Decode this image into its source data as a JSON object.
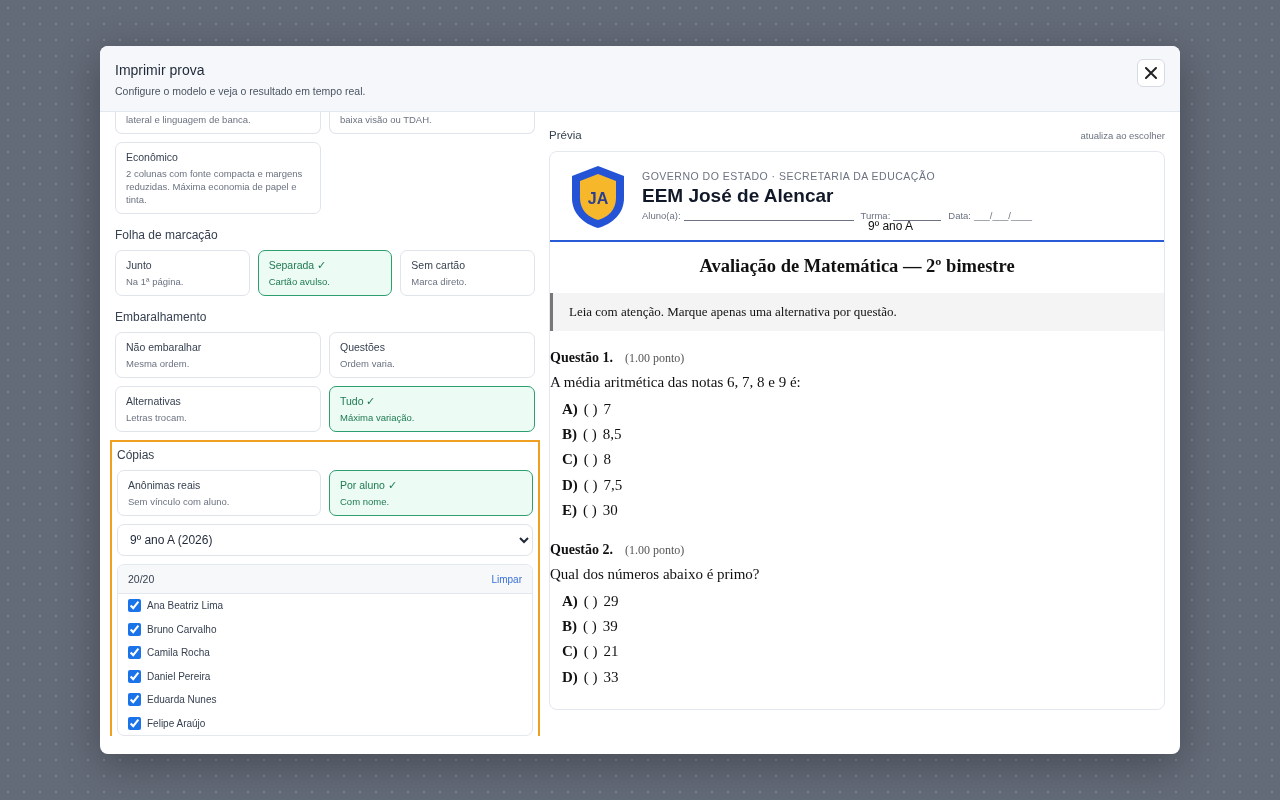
{
  "dialog": {
    "title": "Imprimir prova",
    "subtitle": "Configure o modelo e veja o resultado em tempo real."
  },
  "layout_options": [
    {
      "description": "lateral e linguagem de banca.",
      "selected": false
    },
    {
      "description": "baixa visão ou TDAH.",
      "selected": false
    },
    {
      "title": "Econômico",
      "description": "2 colunas com fonte compacta e margens reduzidas. Máxima economia de papel e tinta.",
      "selected": false
    }
  ],
  "sections": [
    {
      "heading": "Folha de marcação",
      "options": [
        {
          "title": "Junto",
          "description": "Na 1ª página.",
          "selected": false
        },
        {
          "title": "Separada ✓",
          "description": "Cartão avulso.",
          "selected": true
        },
        {
          "title": "Sem cartão",
          "description": "Marca direto.",
          "selected": false
        }
      ]
    },
    {
      "heading": "Embaralhamento",
      "options": [
        {
          "title": "Não embaralhar",
          "description": "Mesma ordem.",
          "selected": false
        },
        {
          "title": "Questões",
          "description": "Ordem varia.",
          "selected": false
        },
        {
          "title": "Alternativas",
          "description": "Letras trocam.",
          "selected": false
        },
        {
          "title": "Tudo ✓",
          "description": "Máxima variação.",
          "selected": true
        }
      ]
    }
  ],
  "copies": {
    "heading": "Cópias",
    "highlighted": true,
    "options": [
      {
        "title": "Anônimas reais",
        "description": "Sem vínculo com aluno.",
        "selected": false
      },
      {
        "title": "Por aluno ✓",
        "description": "Com nome.",
        "selected": true
      }
    ],
    "class_select": "9º ano A (2026)",
    "count": "20/20",
    "clear_link": "Limpar",
    "students": [
      {
        "name": "Ana Beatriz Lima",
        "checked": true
      },
      {
        "name": "Bruno Carvalho",
        "checked": true
      },
      {
        "name": "Camila Rocha",
        "checked": true
      },
      {
        "name": "Daniel Pereira",
        "checked": true
      },
      {
        "name": "Eduarda Nunes",
        "checked": true
      },
      {
        "name": "Felipe Araújo",
        "checked": true
      }
    ]
  },
  "preview": {
    "label": "Prévia",
    "hint": "atualiza ao escolher",
    "sheet": {
      "logo_initials": "JA",
      "org": "GOVERNO DO ESTADO · SECRETARIA DA EDUCAÇÃO",
      "school": "EEM José de Alencar",
      "student_label": "Aluno(a):",
      "class_label": "Turma:",
      "class_value": "9º ano A",
      "date_label": "Data:",
      "date_blank": "___/___/____",
      "title": "Avaliação de Matemática — 2º bimestre",
      "instructions": "Leia com atenção. Marque apenas uma alternativa por questão.",
      "questions": [
        {
          "label": "Questão 1.",
          "points": "(1.00 ponto)",
          "text": "A média aritmética das notas 6, 7, 8 e 9 é:",
          "options": [
            {
              "letter": "A)",
              "mark": "( )",
              "text": "7"
            },
            {
              "letter": "B)",
              "mark": "( )",
              "text": "8,5"
            },
            {
              "letter": "C)",
              "mark": "( )",
              "text": "8"
            },
            {
              "letter": "D)",
              "mark": "( )",
              "text": "7,5"
            },
            {
              "letter": "E)",
              "mark": "( )",
              "text": "30"
            }
          ]
        },
        {
          "label": "Questão 2.",
          "points": "(1.00 ponto)",
          "text": "Qual dos números abaixo é primo?",
          "options": [
            {
              "letter": "A)",
              "mark": "( )",
              "text": "29"
            },
            {
              "letter": "B)",
              "mark": "( )",
              "text": "39"
            },
            {
              "letter": "C)",
              "mark": "( )",
              "text": "21"
            },
            {
              "letter": "D)",
              "mark": "( )",
              "text": "33"
            }
          ]
        }
      ]
    }
  }
}
